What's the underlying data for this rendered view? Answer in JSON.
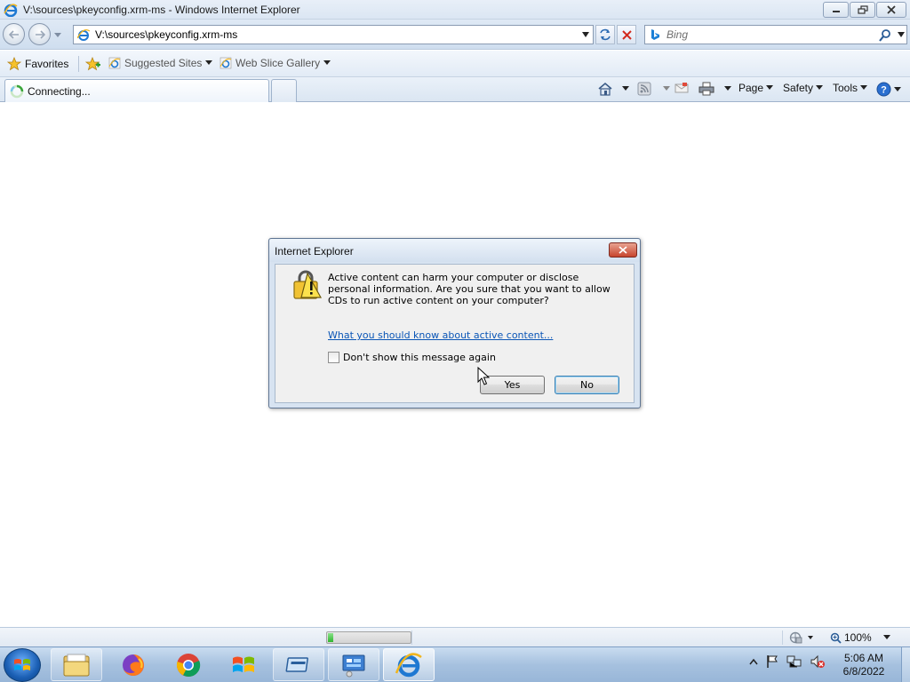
{
  "window": {
    "title": "V:\\sources\\pkeyconfig.xrm-ms - Windows Internet Explorer"
  },
  "navigation": {
    "address_url": "V:\\sources\\pkeyconfig.xrm-ms",
    "search_placeholder": "Bing"
  },
  "favorites_bar": {
    "favorites_label": "Favorites",
    "items": [
      {
        "label": "Suggested Sites"
      },
      {
        "label": "Web Slice Gallery"
      }
    ]
  },
  "tabs": [
    {
      "title": "Connecting..."
    }
  ],
  "command_bar": {
    "page_label": "Page",
    "safety_label": "Safety",
    "tools_label": "Tools"
  },
  "dialog": {
    "title": "Internet Explorer",
    "message": "Active content can harm your computer or disclose personal information. Are you sure that you want to allow CDs to run active content on your computer?",
    "link_text": "What you should know about active content...",
    "checkbox_label": "Don't show this message again",
    "checkbox_checked": false,
    "yes_label": "Yes",
    "no_label": "No"
  },
  "status_bar": {
    "progress": 0.06,
    "zoom": "100%"
  },
  "taskbar": {
    "time": "5:06 AM",
    "date": "6/8/2022",
    "pinned": [
      "windows-explorer",
      "firefox",
      "chrome",
      "windows-media",
      "desktop-switcher",
      "remote-desktop",
      "internet-explorer"
    ]
  },
  "colors": {
    "accent": "#0a55b6",
    "dialog_frame": "#d7e3f1",
    "close_red": "#c7442d"
  }
}
